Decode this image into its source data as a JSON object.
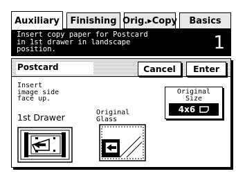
{
  "tabs": [
    {
      "label": "Auxiliary",
      "active": true
    },
    {
      "label": "Finishing",
      "active": false
    },
    {
      "label": "Orig.▸Copy",
      "active": false
    },
    {
      "label": "Basics",
      "active": false
    }
  ],
  "message": {
    "text": "Insert copy paper for Postcard\nin 1st drawer in landscape\nposition.",
    "count": "1"
  },
  "panel": {
    "title": "Postcard",
    "cancel_label": "Cancel",
    "enter_label": "Enter",
    "instruction": "Insert\nimage side\nface up.",
    "original_size": {
      "label": "Original\nSize",
      "value": "4x6"
    },
    "drawer_label": "1st Drawer",
    "glass_label": "Original\nGlass"
  },
  "icons": {
    "orientation": "landscape-card-icon",
    "drawer": "drawer-feed-illustration",
    "glass": "glass-placement-illustration"
  }
}
